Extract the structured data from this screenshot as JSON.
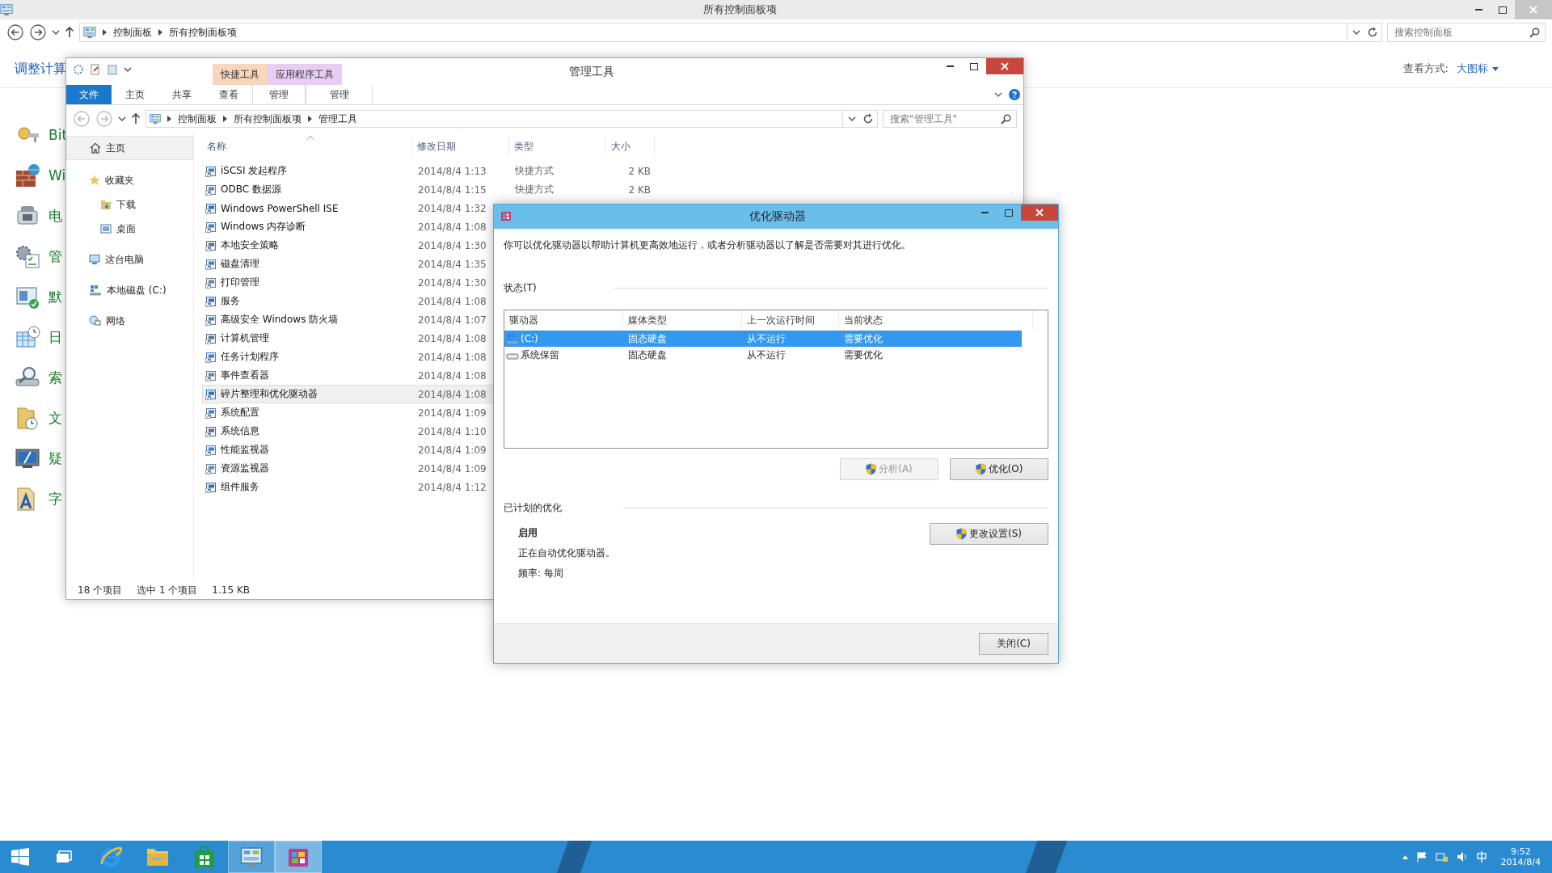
{
  "control_panel": {
    "title": "所有控制面板项",
    "breadcrumb": [
      "控制面板",
      "所有控制面板项"
    ],
    "search": {
      "placeholder": "搜索控制面板"
    },
    "heading": "调整计算",
    "view_label": "查看方式:",
    "view_value": "大图标",
    "items": [
      {
        "label": "Bit",
        "kind": "key"
      },
      {
        "label": "Wi",
        "kind": "firewall"
      },
      {
        "label": "电",
        "kind": "phone"
      },
      {
        "label": "管",
        "kind": "tools"
      },
      {
        "label": "默",
        "kind": "defaults"
      },
      {
        "label": "日",
        "kind": "calendar"
      },
      {
        "label": "索",
        "kind": "search"
      },
      {
        "label": "文",
        "kind": "folder"
      },
      {
        "label": "疑",
        "kind": "monitor"
      },
      {
        "label": "字",
        "kind": "font"
      }
    ]
  },
  "explorer": {
    "title": "管理工具",
    "context_tabs": [
      {
        "label": "快捷工具",
        "color": "#f8d5bd"
      },
      {
        "label": "应用程序工具",
        "color": "#e8cdf2"
      }
    ],
    "ribbon_tabs": [
      {
        "label": "文件",
        "kind": "file"
      },
      {
        "label": "主页",
        "kind": "normal"
      },
      {
        "label": "共享",
        "kind": "normal"
      },
      {
        "label": "查看",
        "kind": "normal"
      },
      {
        "label": "管理",
        "kind": "context"
      },
      {
        "label": "管理",
        "kind": "context"
      }
    ],
    "breadcrumb": [
      "控制面板",
      "所有控制面板项",
      "管理工具"
    ],
    "search": {
      "placeholder": "搜索\"管理工具\""
    },
    "nav": [
      {
        "label": "主页",
        "kind": "home",
        "selected": true
      },
      {
        "label": "收藏夹",
        "kind": "star",
        "selected": false,
        "children": [
          {
            "label": "下载",
            "kind": "download",
            "selected": false
          },
          {
            "label": "桌面",
            "kind": "desktop",
            "selected": false
          }
        ]
      },
      {
        "label": "这台电脑",
        "kind": "pc",
        "selected": false
      },
      {
        "label": "本地磁盘 (C:)",
        "kind": "drive",
        "selected": false
      },
      {
        "label": "网络",
        "kind": "network",
        "selected": false
      }
    ],
    "columns": [
      "名称",
      "修改日期",
      "类型",
      "大小"
    ],
    "files": [
      {
        "name": "iSCSI 发起程序",
        "date": "2014/8/4 1:13",
        "type": "快捷方式",
        "size": "2 KB",
        "selected": false
      },
      {
        "name": "ODBC 数据源",
        "date": "2014/8/4 1:15",
        "type": "快捷方式",
        "size": "2 KB",
        "selected": false
      },
      {
        "name": "Windows PowerShell ISE",
        "date": "2014/8/4 1:32",
        "selected": false
      },
      {
        "name": "Windows 内存诊断",
        "date": "2014/8/4 1:08",
        "selected": false
      },
      {
        "name": "本地安全策略",
        "date": "2014/8/4 1:30",
        "selected": false
      },
      {
        "name": "磁盘清理",
        "date": "2014/8/4 1:35",
        "selected": false
      },
      {
        "name": "打印管理",
        "date": "2014/8/4 1:30",
        "selected": false
      },
      {
        "name": "服务",
        "date": "2014/8/4 1:08",
        "selected": false
      },
      {
        "name": "高级安全 Windows 防火墙",
        "date": "2014/8/4 1:07",
        "selected": false
      },
      {
        "name": "计算机管理",
        "date": "2014/8/4 1:08",
        "selected": false
      },
      {
        "name": "任务计划程序",
        "date": "2014/8/4 1:08",
        "selected": false
      },
      {
        "name": "事件查看器",
        "date": "2014/8/4 1:08",
        "selected": false
      },
      {
        "name": "碎片整理和优化驱动器",
        "date": "2014/8/4 1:08",
        "selected": true
      },
      {
        "name": "系统配置",
        "date": "2014/8/4 1:09",
        "selected": false
      },
      {
        "name": "系统信息",
        "date": "2014/8/4 1:10",
        "selected": false
      },
      {
        "name": "性能监视器",
        "date": "2014/8/4 1:09",
        "selected": false
      },
      {
        "name": "资源监视器",
        "date": "2014/8/4 1:09",
        "selected": false
      },
      {
        "name": "组件服务",
        "date": "2014/8/4 1:12",
        "selected": false
      }
    ],
    "status": [
      "18 个项目",
      "选中 1 个项目",
      "1.15 KB"
    ]
  },
  "dialog": {
    "title": "优化驱动器",
    "description": "你可以优化驱动器以帮助计算机更高效地运行，或者分析驱动器以了解是否需要对其进行优化。",
    "status_label": "状态(T)",
    "columns": [
      "驱动器",
      "媒体类型",
      "上一次运行时间",
      "当前状态"
    ],
    "drives": [
      {
        "name": "(C:)",
        "kind": "system",
        "media": "固态硬盘",
        "last_run": "从不运行",
        "state": "需要优化",
        "selected": true
      },
      {
        "name": "系统保留",
        "kind": "reserved",
        "media": "固态硬盘",
        "last_run": "从不运行",
        "state": "需要优化",
        "selected": false
      }
    ],
    "actions": [
      {
        "label": "分析(A)",
        "disabled": true
      },
      {
        "label": "优化(O)",
        "disabled": false
      }
    ],
    "scheduled_label": "已计划的优化",
    "schedule_state": "启用",
    "schedule_text": "正在自动优化驱动器。",
    "frequency": "频率: 每周",
    "settings_button": "更改设置(S)",
    "close_button": "关闭(C)"
  },
  "taskbar": {
    "apps": [
      {
        "kind": "task-view",
        "running": false,
        "selected": false
      },
      {
        "kind": "browser",
        "running": false,
        "selected": false
      },
      {
        "kind": "folder",
        "running": false,
        "selected": false
      },
      {
        "kind": "store",
        "running": false,
        "selected": false
      },
      {
        "kind": "control-panel",
        "running": true,
        "selected": false
      },
      {
        "kind": "defrag",
        "running": true,
        "selected": true
      }
    ],
    "time": "9:52",
    "date": "2014/8/4"
  }
}
